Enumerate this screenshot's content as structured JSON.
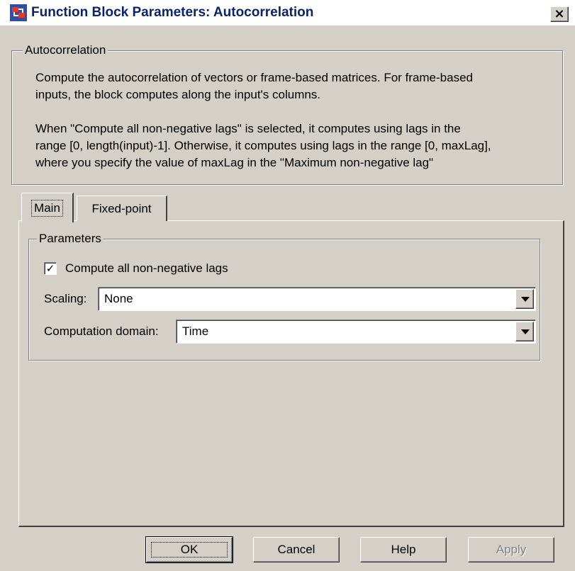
{
  "window": {
    "title": "Function Block Parameters: Autocorrelation",
    "close_glyph": "×"
  },
  "description": {
    "legend": "Autocorrelation",
    "lines": [
      "Compute the autocorrelation of vectors or frame-based matrices. For frame-based",
      "inputs, the block computes along the input's columns.",
      "",
      "When \"Compute all non-negative lags\" is selected, it computes using lags in the",
      "range [0, length(input)-1]. Otherwise, it computes using lags in the range [0, maxLag],",
      "where you specify the value of maxLag in the \"Maximum non-negative lag\""
    ]
  },
  "tabs": [
    {
      "label": "Main",
      "selected": true
    },
    {
      "label": "Fixed-point",
      "selected": false
    }
  ],
  "parameters": {
    "legend": "Parameters",
    "compute_all_lags": {
      "label": "Compute all non-negative lags",
      "checked": true,
      "check_glyph": "✓"
    },
    "scaling": {
      "label": "Scaling:",
      "value": "None"
    },
    "computation_domain": {
      "label": "Computation domain:",
      "value": "Time"
    }
  },
  "buttons": {
    "ok": "OK",
    "cancel": "Cancel",
    "help": "Help",
    "apply": "Apply"
  },
  "colors": {
    "face": "#d4d0c8",
    "title_text": "#0a246a",
    "disabled_text": "#808080"
  }
}
